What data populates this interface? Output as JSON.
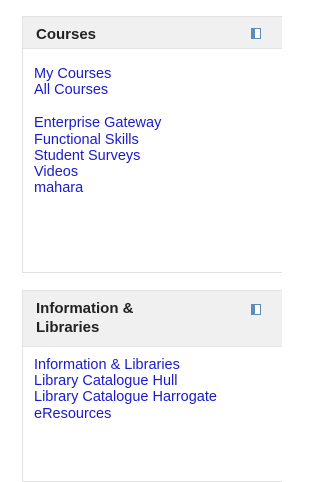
{
  "courses_block": {
    "title": "Courses",
    "main_links": [
      "My Courses",
      "All Courses"
    ],
    "extra_links": [
      "Enterprise Gateway",
      "Functional Skills",
      "Student Surveys",
      "Videos",
      "mahara"
    ]
  },
  "info_block": {
    "title": "Information & Libraries",
    "links": [
      "Information & Libraries",
      "Library Catalogue Hull",
      "Library Catalogue Harrogate",
      "eResources"
    ]
  },
  "colors": {
    "link": "#1a1acd",
    "header_bg": "#f0f0f0",
    "border": "#e2e2e2",
    "dock_icon": "#5b8db8"
  },
  "icons": {
    "dock": "dock-block-icon"
  }
}
